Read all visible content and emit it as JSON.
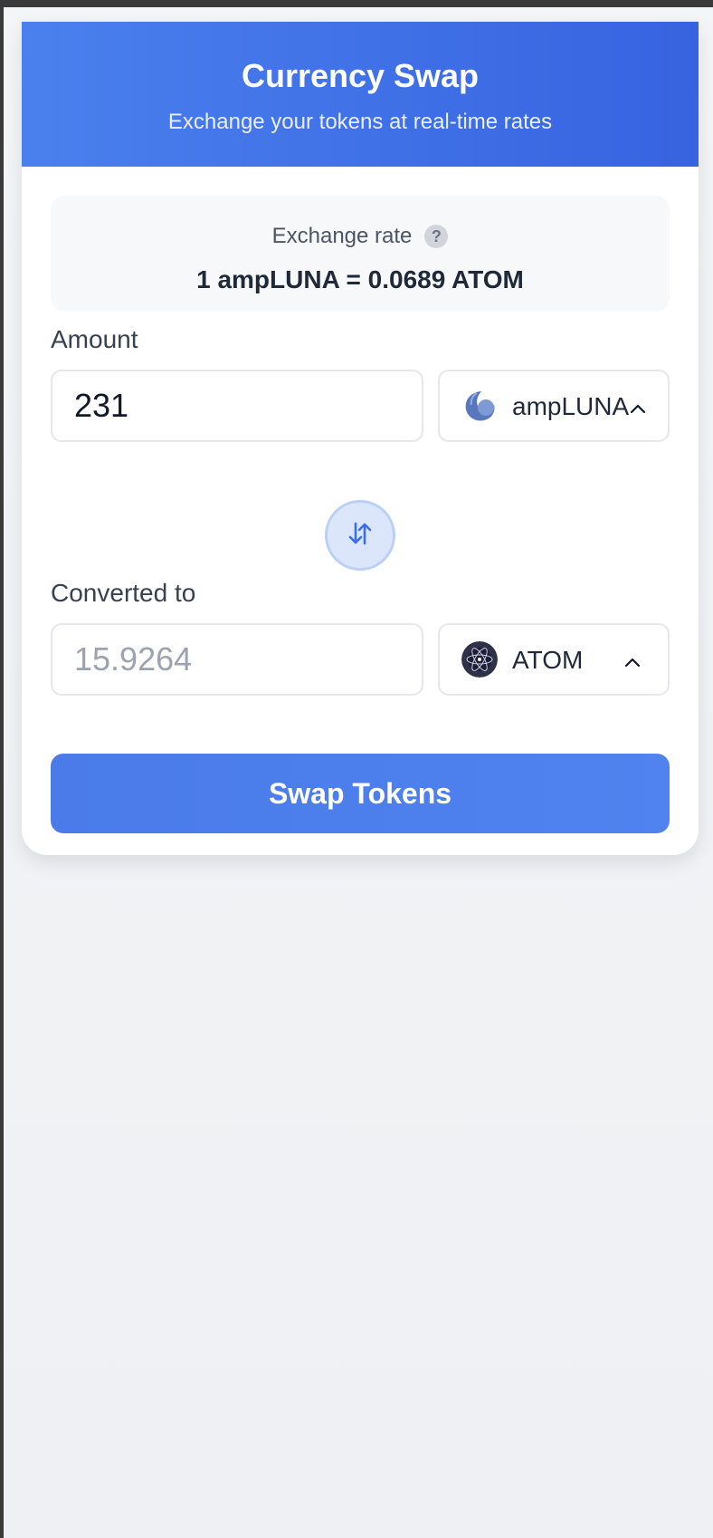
{
  "header": {
    "title": "Currency Swap",
    "subtitle": "Exchange your tokens at real-time rates"
  },
  "rate": {
    "label": "Exchange rate",
    "help_glyph": "?",
    "value": "1 ampLUNA = 0.0689 ATOM"
  },
  "from": {
    "label": "Amount",
    "amount": "231",
    "token": "ampLUNA",
    "token_icon": "ampluna-token-icon"
  },
  "to": {
    "label": "Converted to",
    "amount": "15.9264",
    "token": "ATOM",
    "token_icon": "atom-token-icon"
  },
  "actions": {
    "swap_label": "Swap Tokens",
    "swap_direction_icon": "swap-vertical-arrows-icon"
  },
  "colors": {
    "primary": "#3B6FE8",
    "header_gradient_start": "#4A80EE",
    "header_gradient_end": "#3763E0",
    "swap_button": "#4D7FEC",
    "ampluna": "#5B7FC4",
    "atom": "#2E3148"
  }
}
